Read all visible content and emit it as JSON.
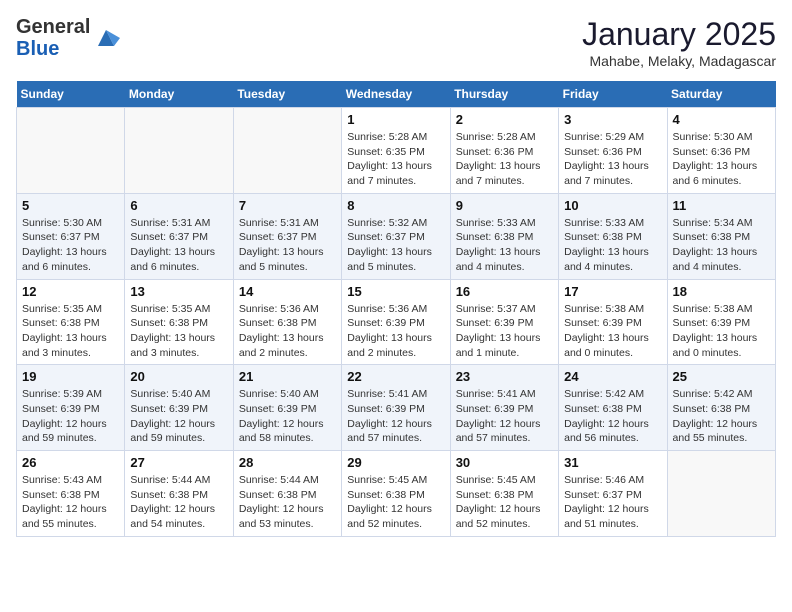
{
  "logo": {
    "general": "General",
    "blue": "Blue"
  },
  "title": "January 2025",
  "subtitle": "Mahabe, Melaky, Madagascar",
  "headers": [
    "Sunday",
    "Monday",
    "Tuesday",
    "Wednesday",
    "Thursday",
    "Friday",
    "Saturday"
  ],
  "weeks": [
    [
      {
        "day": "",
        "info": ""
      },
      {
        "day": "",
        "info": ""
      },
      {
        "day": "",
        "info": ""
      },
      {
        "day": "1",
        "info": "Sunrise: 5:28 AM\nSunset: 6:35 PM\nDaylight: 13 hours\nand 7 minutes."
      },
      {
        "day": "2",
        "info": "Sunrise: 5:28 AM\nSunset: 6:36 PM\nDaylight: 13 hours\nand 7 minutes."
      },
      {
        "day": "3",
        "info": "Sunrise: 5:29 AM\nSunset: 6:36 PM\nDaylight: 13 hours\nand 7 minutes."
      },
      {
        "day": "4",
        "info": "Sunrise: 5:30 AM\nSunset: 6:36 PM\nDaylight: 13 hours\nand 6 minutes."
      }
    ],
    [
      {
        "day": "5",
        "info": "Sunrise: 5:30 AM\nSunset: 6:37 PM\nDaylight: 13 hours\nand 6 minutes."
      },
      {
        "day": "6",
        "info": "Sunrise: 5:31 AM\nSunset: 6:37 PM\nDaylight: 13 hours\nand 6 minutes."
      },
      {
        "day": "7",
        "info": "Sunrise: 5:31 AM\nSunset: 6:37 PM\nDaylight: 13 hours\nand 5 minutes."
      },
      {
        "day": "8",
        "info": "Sunrise: 5:32 AM\nSunset: 6:37 PM\nDaylight: 13 hours\nand 5 minutes."
      },
      {
        "day": "9",
        "info": "Sunrise: 5:33 AM\nSunset: 6:38 PM\nDaylight: 13 hours\nand 4 minutes."
      },
      {
        "day": "10",
        "info": "Sunrise: 5:33 AM\nSunset: 6:38 PM\nDaylight: 13 hours\nand 4 minutes."
      },
      {
        "day": "11",
        "info": "Sunrise: 5:34 AM\nSunset: 6:38 PM\nDaylight: 13 hours\nand 4 minutes."
      }
    ],
    [
      {
        "day": "12",
        "info": "Sunrise: 5:35 AM\nSunset: 6:38 PM\nDaylight: 13 hours\nand 3 minutes."
      },
      {
        "day": "13",
        "info": "Sunrise: 5:35 AM\nSunset: 6:38 PM\nDaylight: 13 hours\nand 3 minutes."
      },
      {
        "day": "14",
        "info": "Sunrise: 5:36 AM\nSunset: 6:38 PM\nDaylight: 13 hours\nand 2 minutes."
      },
      {
        "day": "15",
        "info": "Sunrise: 5:36 AM\nSunset: 6:39 PM\nDaylight: 13 hours\nand 2 minutes."
      },
      {
        "day": "16",
        "info": "Sunrise: 5:37 AM\nSunset: 6:39 PM\nDaylight: 13 hours\nand 1 minute."
      },
      {
        "day": "17",
        "info": "Sunrise: 5:38 AM\nSunset: 6:39 PM\nDaylight: 13 hours\nand 0 minutes."
      },
      {
        "day": "18",
        "info": "Sunrise: 5:38 AM\nSunset: 6:39 PM\nDaylight: 13 hours\nand 0 minutes."
      }
    ],
    [
      {
        "day": "19",
        "info": "Sunrise: 5:39 AM\nSunset: 6:39 PM\nDaylight: 12 hours\nand 59 minutes."
      },
      {
        "day": "20",
        "info": "Sunrise: 5:40 AM\nSunset: 6:39 PM\nDaylight: 12 hours\nand 59 minutes."
      },
      {
        "day": "21",
        "info": "Sunrise: 5:40 AM\nSunset: 6:39 PM\nDaylight: 12 hours\nand 58 minutes."
      },
      {
        "day": "22",
        "info": "Sunrise: 5:41 AM\nSunset: 6:39 PM\nDaylight: 12 hours\nand 57 minutes."
      },
      {
        "day": "23",
        "info": "Sunrise: 5:41 AM\nSunset: 6:39 PM\nDaylight: 12 hours\nand 57 minutes."
      },
      {
        "day": "24",
        "info": "Sunrise: 5:42 AM\nSunset: 6:38 PM\nDaylight: 12 hours\nand 56 minutes."
      },
      {
        "day": "25",
        "info": "Sunrise: 5:42 AM\nSunset: 6:38 PM\nDaylight: 12 hours\nand 55 minutes."
      }
    ],
    [
      {
        "day": "26",
        "info": "Sunrise: 5:43 AM\nSunset: 6:38 PM\nDaylight: 12 hours\nand 55 minutes."
      },
      {
        "day": "27",
        "info": "Sunrise: 5:44 AM\nSunset: 6:38 PM\nDaylight: 12 hours\nand 54 minutes."
      },
      {
        "day": "28",
        "info": "Sunrise: 5:44 AM\nSunset: 6:38 PM\nDaylight: 12 hours\nand 53 minutes."
      },
      {
        "day": "29",
        "info": "Sunrise: 5:45 AM\nSunset: 6:38 PM\nDaylight: 12 hours\nand 52 minutes."
      },
      {
        "day": "30",
        "info": "Sunrise: 5:45 AM\nSunset: 6:38 PM\nDaylight: 12 hours\nand 52 minutes."
      },
      {
        "day": "31",
        "info": "Sunrise: 5:46 AM\nSunset: 6:37 PM\nDaylight: 12 hours\nand 51 minutes."
      },
      {
        "day": "",
        "info": ""
      }
    ]
  ]
}
